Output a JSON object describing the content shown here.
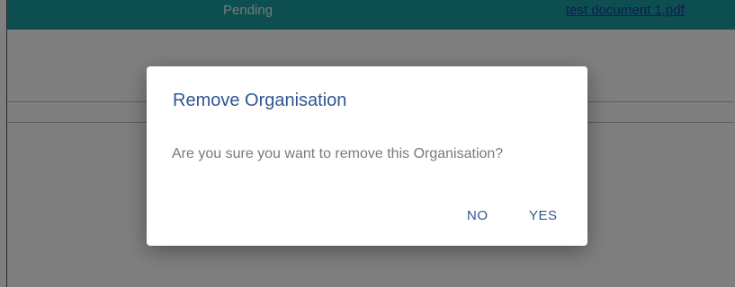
{
  "background": {
    "row_status": "Pending",
    "row_document_link": "test document 1.pdf",
    "accent_color": "#1b9fa0"
  },
  "dialog": {
    "title": "Remove Organisation",
    "message": "Are you sure you want to remove this Organisation?",
    "buttons": {
      "no_label": "NO",
      "yes_label": "YES"
    },
    "accent_color": "#2f5690"
  }
}
